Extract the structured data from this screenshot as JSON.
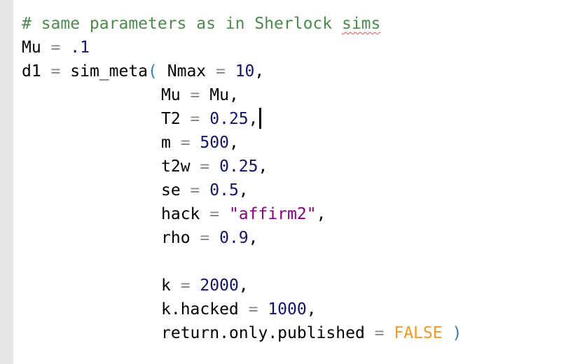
{
  "editor": {
    "lines": [
      {
        "comment": "# same parameters as in Sherlock ",
        "comment_flagged": "sims"
      },
      {
        "name": "Mu",
        "op": " = ",
        "value": ".1"
      },
      {
        "name": "d1",
        "op": " = ",
        "func": "sim_meta",
        "open": "(",
        "arg": "Nmax",
        "arg_op": " = ",
        "value": "10",
        "comma": ","
      },
      {
        "arg": "Mu",
        "op": " = ",
        "value": "Mu",
        "comma": ","
      },
      {
        "arg": "T2",
        "op": " = ",
        "value": "0.25",
        "comma": ","
      },
      {
        "arg": "m",
        "op": " = ",
        "value": "500",
        "comma": ","
      },
      {
        "arg": "t2w",
        "op": " = ",
        "value": "0.25",
        "comma": ","
      },
      {
        "arg": "se",
        "op": " = ",
        "value": "0.5",
        "comma": ","
      },
      {
        "arg": "hack",
        "op": " = ",
        "value": "\"affirm2\"",
        "comma": ","
      },
      {
        "arg": "rho",
        "op": " = ",
        "value": "0.9",
        "comma": ","
      },
      {
        "arg": "k",
        "op": " = ",
        "value": "2000",
        "comma": ","
      },
      {
        "arg": "k.hacked",
        "op": " = ",
        "value": "1000",
        "comma": ","
      },
      {
        "arg": "return.only.published",
        "op": " = ",
        "value": "FALSE",
        "close": " )"
      }
    ]
  },
  "colors": {
    "comment": "#4b8a4b",
    "number": "#141466",
    "operator": "#8a8a8a",
    "string": "#800080",
    "keyword": "#ee9a2a",
    "bracket": "#3d7fb5",
    "gutter": "#e6e6e6"
  }
}
